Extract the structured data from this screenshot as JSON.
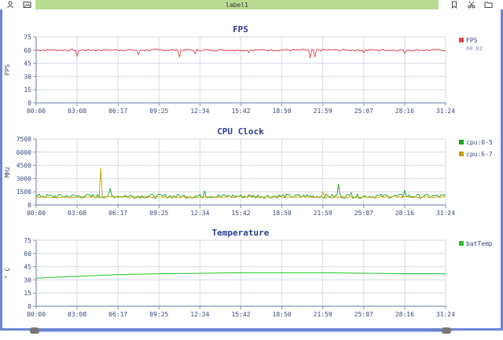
{
  "toolbar": {
    "label": "label1",
    "left_icons": [
      "person-icon",
      "image-icon"
    ],
    "right_icons": [
      "bookmark-icon",
      "scissors-icon",
      "folder-icon"
    ]
  },
  "colors": {
    "accent_frame": "#6d86d6",
    "label_bar": "#b9dc93",
    "fps": "#e8414f",
    "cpu_big": "#1aa51a",
    "cpu_little": "#c8a000",
    "temp": "#22c322",
    "title": "#2a3f8f"
  },
  "time_ticks": [
    "00:00",
    "03:08",
    "06:17",
    "09:25",
    "12:34",
    "15:42",
    "18:50",
    "21:59",
    "25:07",
    "28:16",
    "31:24"
  ],
  "chart_data": [
    {
      "type": "line",
      "title": "FPS",
      "ylabel": "FPS",
      "ylim": [
        0,
        75
      ],
      "yticks": [
        0,
        15,
        30,
        45,
        60,
        75
      ],
      "grid": true,
      "legend_position": "right",
      "series": [
        {
          "name": "FPS",
          "legend_value": "60.02",
          "baseline": 60,
          "dips": [
            {
              "t": 0.1,
              "v": 53
            },
            {
              "t": 0.25,
              "v": 55
            },
            {
              "t": 0.35,
              "v": 52
            },
            {
              "t": 0.39,
              "v": 56
            },
            {
              "t": 0.52,
              "v": 57
            },
            {
              "t": 0.67,
              "v": 51
            },
            {
              "t": 0.68,
              "v": 52
            },
            {
              "t": 0.8,
              "v": 57
            },
            {
              "t": 0.9,
              "v": 56
            }
          ]
        }
      ]
    },
    {
      "type": "line",
      "title": "CPU Clock",
      "ylabel": "MHz",
      "ylim": [
        0,
        7500
      ],
      "yticks": [
        0,
        1500,
        3000,
        4500,
        6000,
        7500
      ],
      "grid": true,
      "legend_position": "right",
      "series": [
        {
          "name": "cpu:0-5",
          "baseline": 1000,
          "spikes": [
            {
              "t": 0.18,
              "v": 1900
            },
            {
              "t": 0.41,
              "v": 1600
            },
            {
              "t": 0.74,
              "v": 2400
            },
            {
              "t": 0.77,
              "v": 1400
            },
            {
              "t": 0.9,
              "v": 1700
            }
          ]
        },
        {
          "name": "cpu:6-7",
          "baseline": 900,
          "spikes": [
            {
              "t": 0.158,
              "v": 4200
            },
            {
              "t": 0.7,
              "v": 1500
            }
          ]
        }
      ]
    },
    {
      "type": "line",
      "title": "Temperature",
      "ylabel": "° C",
      "ylim": [
        0,
        75
      ],
      "yticks": [
        0,
        15,
        30,
        45,
        60,
        75
      ],
      "grid": true,
      "legend_position": "right",
      "series": [
        {
          "name": "batTemp",
          "points": [
            [
              0.0,
              32
            ],
            [
              0.1,
              34
            ],
            [
              0.2,
              36
            ],
            [
              0.3,
              37
            ],
            [
              0.4,
              37.5
            ],
            [
              0.5,
              38
            ],
            [
              0.6,
              38
            ],
            [
              0.7,
              38
            ],
            [
              0.8,
              37.5
            ],
            [
              0.9,
              37
            ],
            [
              1.0,
              37
            ]
          ]
        }
      ]
    }
  ],
  "slider": {
    "start": 0,
    "end": 1
  }
}
